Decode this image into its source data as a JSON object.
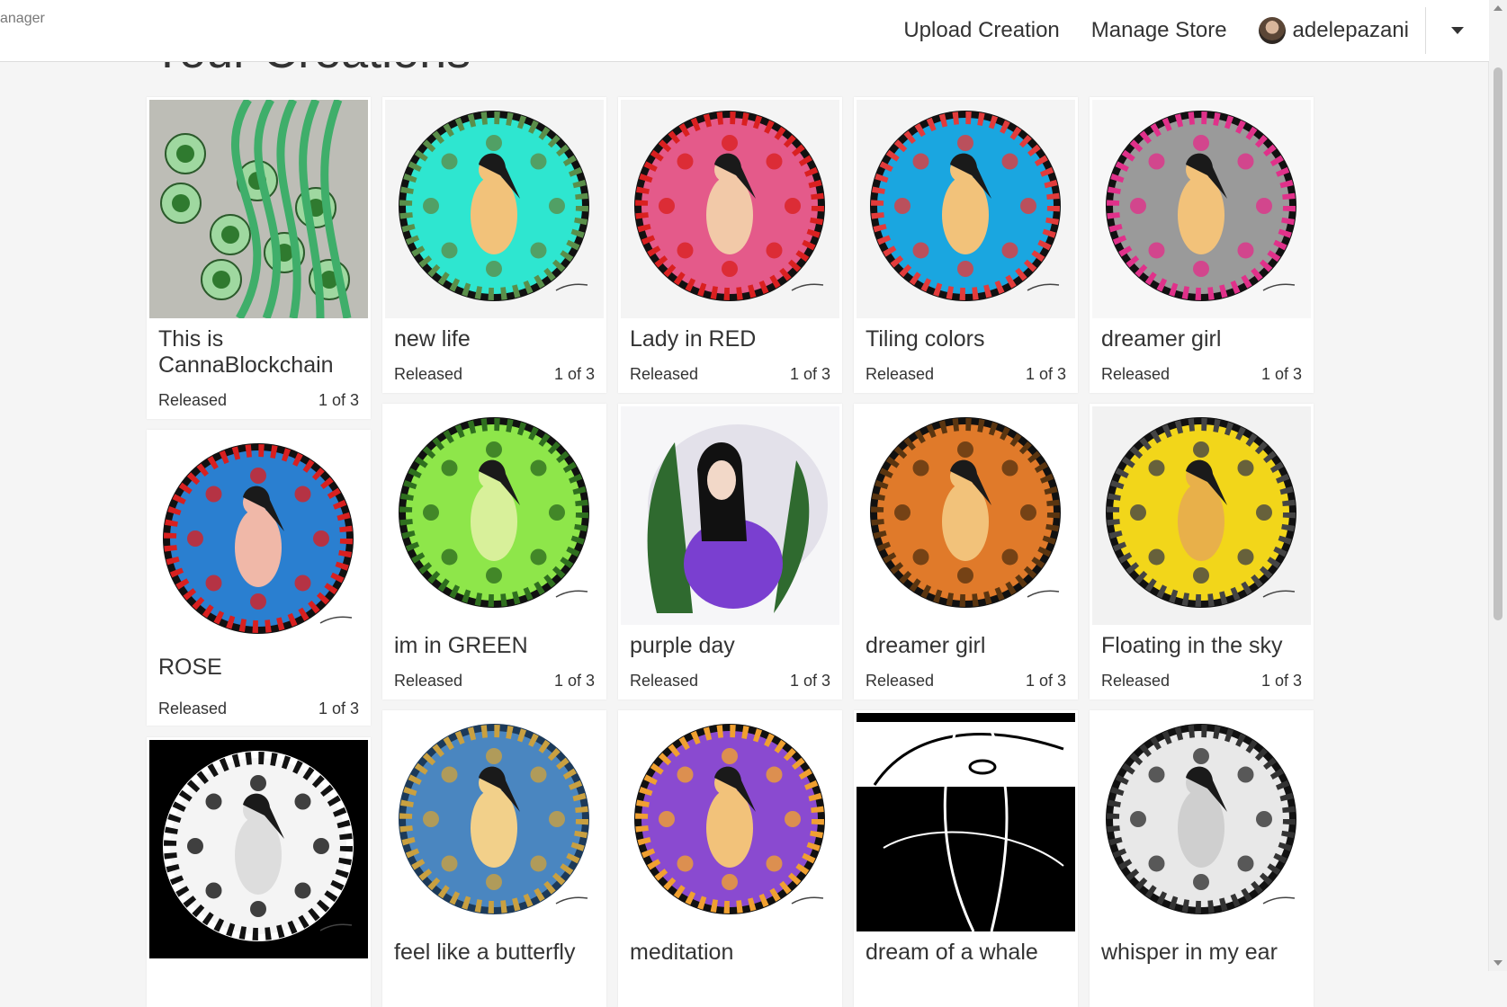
{
  "nav": {
    "brand_fragment": "anager",
    "upload": "Upload Creation",
    "store": "Manage Store",
    "username": "adelepazani"
  },
  "page": {
    "heading": "Your Creations"
  },
  "creations": [
    {
      "title": "This is CannaBlockchain",
      "status": "Released",
      "edition": "1 of 3",
      "art": "vines"
    },
    {
      "title": "new life",
      "status": "Released",
      "edition": "1 of 3",
      "art": "mandala-cyan"
    },
    {
      "title": "Lady in RED",
      "status": "Released",
      "edition": "1 of 3",
      "art": "mandala-red"
    },
    {
      "title": "Tiling colors",
      "status": "Released",
      "edition": "1 of 3",
      "art": "mandala-blue"
    },
    {
      "title": "dreamer girl",
      "status": "Released",
      "edition": "1 of 3",
      "art": "mandala-pink"
    },
    {
      "title": "ROSE",
      "status": "Released",
      "edition": "1 of 3",
      "art": "mandala-rose"
    },
    {
      "title": "im in GREEN",
      "status": "Released",
      "edition": "1 of 3",
      "art": "mandala-green"
    },
    {
      "title": "purple day",
      "status": "Released",
      "edition": "1 of 3",
      "art": "purple"
    },
    {
      "title": "dreamer girl",
      "status": "Released",
      "edition": "1 of 3",
      "art": "mandala-orange"
    },
    {
      "title": "Floating in the sky",
      "status": "Released",
      "edition": "1 of 3",
      "art": "mandala-yellow"
    },
    {
      "title": "",
      "status": "",
      "edition": "",
      "art": "mandala-bw-dark"
    },
    {
      "title": "feel like a butterfly",
      "status": "",
      "edition": "",
      "art": "mandala-sky"
    },
    {
      "title": "meditation",
      "status": "",
      "edition": "",
      "art": "mandala-violet"
    },
    {
      "title": "dream of a whale",
      "status": "",
      "edition": "",
      "art": "whale"
    },
    {
      "title": "whisper in my ear",
      "status": "",
      "edition": "",
      "art": "mandala-bw"
    }
  ],
  "colors": {
    "page_bg": "#f5f5f5",
    "card_bg": "#ffffff",
    "text": "#333333"
  }
}
